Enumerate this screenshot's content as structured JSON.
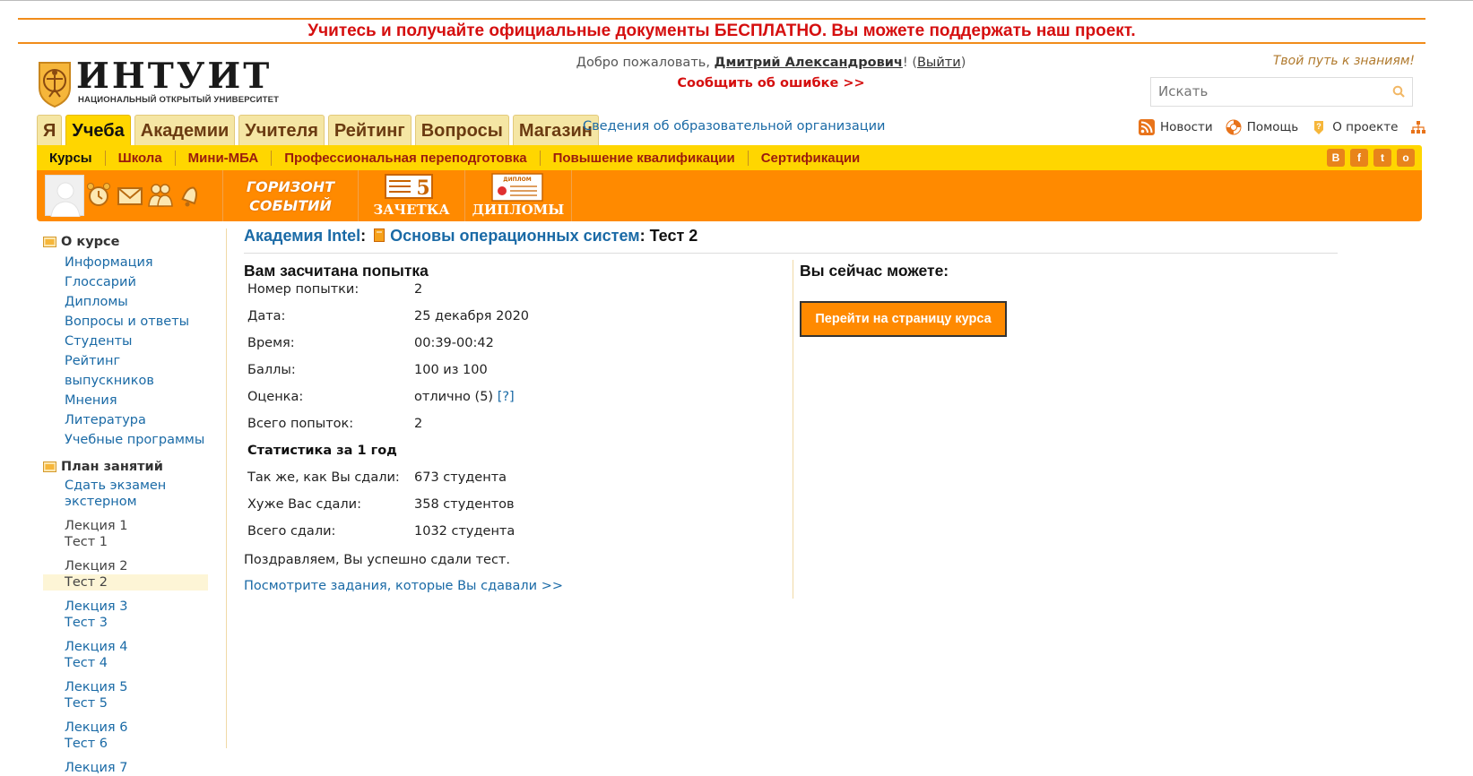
{
  "promo": "Учитесь и получайте официальные документы БЕСПЛАТНО. Вы можете поддержать наш проект.",
  "logo": {
    "word": "ИНТУИТ",
    "sub": "НАЦИОНАЛЬНЫЙ ОТКРЫТЫЙ УНИВЕРСИТЕТ"
  },
  "header": {
    "welcome_prefix": "Добро пожаловать, ",
    "user_name": "Дмитрий Александрович",
    "welcome_mid": "! (",
    "logout": "Выйти",
    "welcome_end": ")",
    "report_error": "Сообщить об ошибке >>",
    "slogan": "Твой путь к знаниям!",
    "search_placeholder": "Искать"
  },
  "main_tabs": [
    "Я",
    "Учеба",
    "Академии",
    "Учителя",
    "Рейтинг",
    "Вопросы",
    "Магазин"
  ],
  "org_info": "Сведения об образовательной организации",
  "right_links": {
    "news": "Новости",
    "help": "Помощь",
    "about": "О проекте"
  },
  "sub_nav": [
    "Курсы",
    "Школа",
    "Мини-МБА",
    "Профессиональная переподготовка",
    "Повышение квалификации",
    "Сертификации"
  ],
  "social": [
    "В",
    "f",
    "t",
    "о"
  ],
  "orange_bar": {
    "horizon": "ГОРИЗОНТ СОБЫТИЙ",
    "zachetka": "ЗАЧЕТКА",
    "zachetka_num": "5",
    "diplomy": "ДИПЛОМЫ",
    "diplom_small": "ДИПЛОМ"
  },
  "sidebar": {
    "about_head": "О курсе",
    "about_links": [
      "Информация",
      "Глоссарий",
      "Дипломы",
      "Вопросы и ответы",
      "Студенты",
      "Рейтинг выпускников",
      "Мнения",
      "Литература",
      "Учебные программы"
    ],
    "plan_head": "План занятий",
    "exam": [
      "Сдать экзамен",
      "экстерном"
    ],
    "lessons": [
      {
        "lecture": "Лекция 1",
        "test": "Тест 1"
      },
      {
        "lecture": "Лекция 2",
        "test": "Тест 2"
      },
      {
        "lecture": "Лекция 3",
        "test": "Тест 3"
      },
      {
        "lecture": "Лекция 4",
        "test": "Тест 4"
      },
      {
        "lecture": "Лекция 5",
        "test": "Тест 5"
      },
      {
        "lecture": "Лекция 6",
        "test": "Тест 6"
      },
      {
        "lecture": "Лекция 7"
      }
    ]
  },
  "breadcrumb": {
    "academy": "Академия Intel",
    "sep": ":",
    "course": "Основы операционных систем",
    "current": ": Тест 2"
  },
  "result": {
    "title": "Вам засчитана попытка",
    "rows": [
      {
        "k": "Номер попытки:",
        "v": "2"
      },
      {
        "k": "Дата:",
        "v": "25 декабря 2020"
      },
      {
        "k": "Время:",
        "v": "00:39-00:42"
      },
      {
        "k": "Баллы:",
        "v": "100 из 100"
      },
      {
        "k": "Оценка:",
        "v": "отлично (5)",
        "link": "[?]"
      },
      {
        "k": "Всего попыток:",
        "v": "2"
      }
    ],
    "stats_title": "Статистика за 1 год",
    "stats": [
      {
        "k": "Так же, как Вы сдали:",
        "v": "673 студента"
      },
      {
        "k": "Хуже Вас сдали:",
        "v": "358 студентов"
      },
      {
        "k": "Всего сдали:",
        "v": "1032 студента"
      }
    ],
    "congrats": "Поздравляем, Вы успешно сдали тест.",
    "view_tasks": "Посмотрите задания, которые Вы сдавали >>"
  },
  "actions": {
    "title": "Вы сейчас можете:",
    "go_course": "Перейти на страницу курса"
  },
  "colors": {
    "accent_orange": "#ff8a00",
    "nav_yellow": "#ffd600",
    "link_blue": "#1a6aa6",
    "alert_red": "#d50f0f"
  }
}
